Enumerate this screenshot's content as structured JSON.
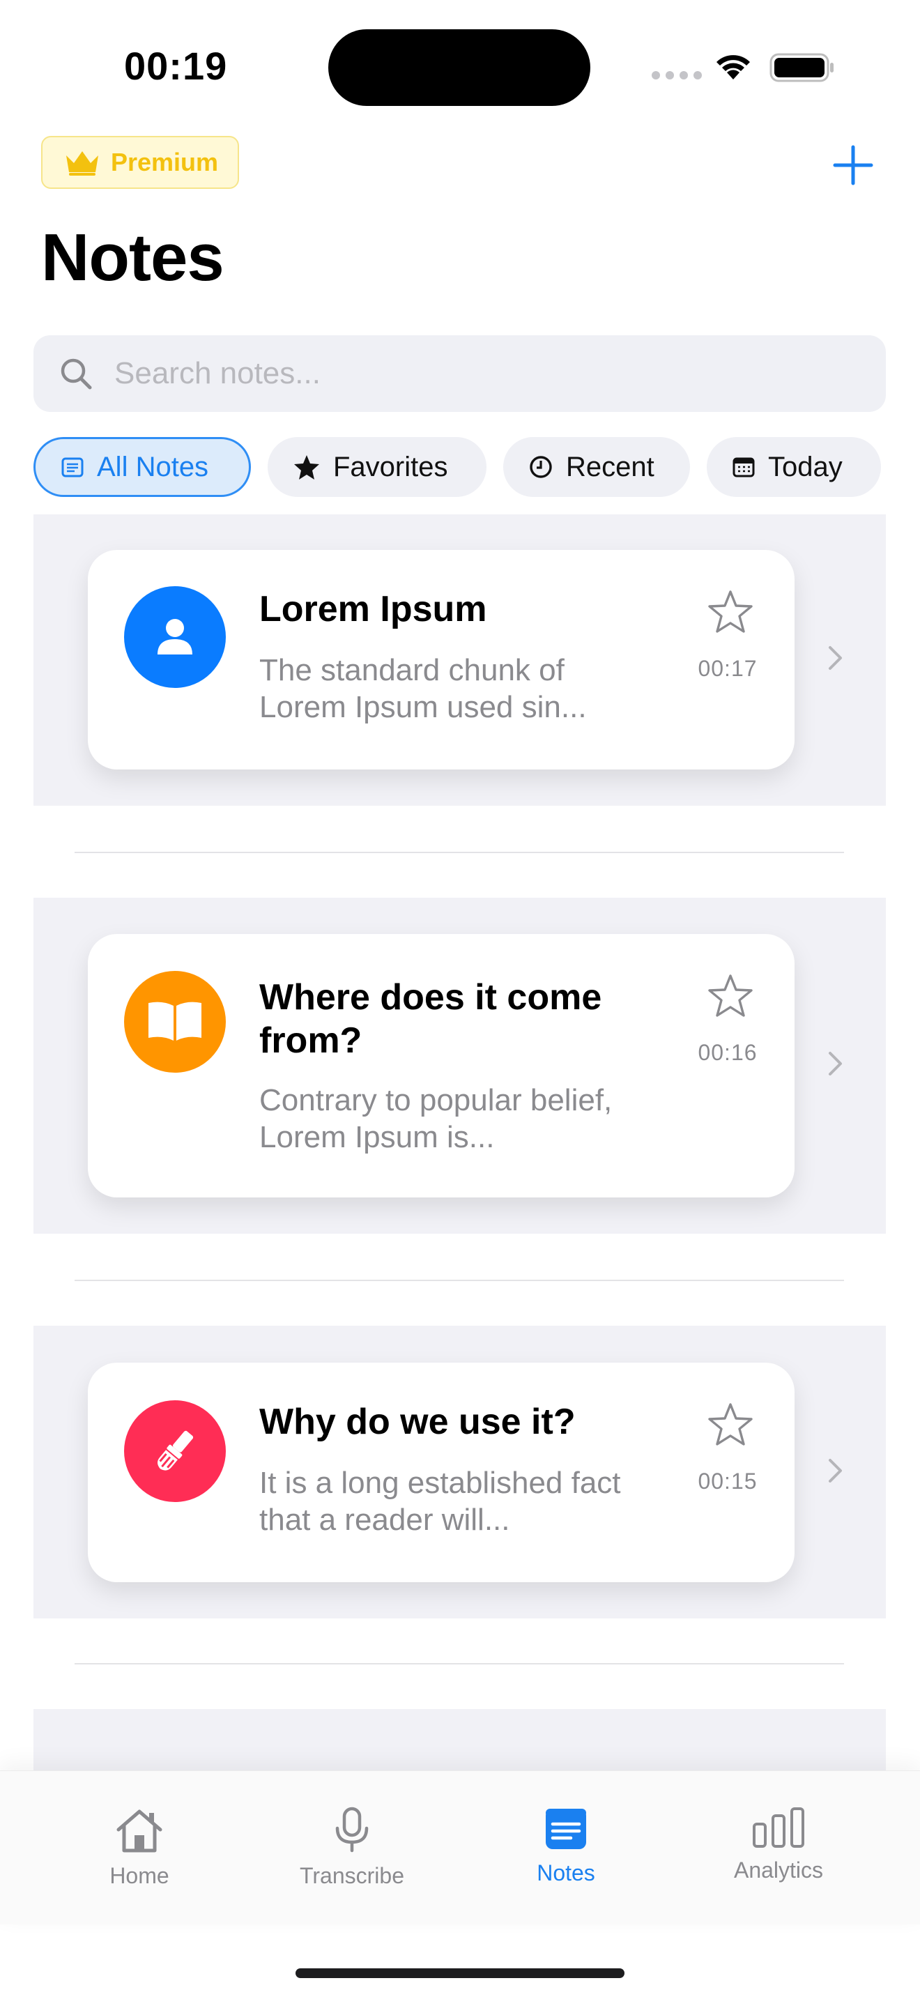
{
  "status": {
    "time": "00:19"
  },
  "header": {
    "premium_label": "Premium",
    "title": "Notes"
  },
  "search": {
    "placeholder": "Search notes..."
  },
  "filters": [
    {
      "label": "All Notes",
      "icon": "list-doc-icon",
      "active": true
    },
    {
      "label": "Favorites",
      "icon": "star-fill-icon",
      "active": false
    },
    {
      "label": "Recent",
      "icon": "clock-icon",
      "active": false
    },
    {
      "label": "Today",
      "icon": "calendar-icon",
      "active": false
    }
  ],
  "notes": [
    {
      "title": "Lorem Ipsum",
      "snippet": "The standard chunk of Lorem Ipsum used sin...",
      "time": "00:17",
      "icon": "person-icon",
      "color": "#0a7cff",
      "favorite": false
    },
    {
      "title": "Where does it come from?",
      "snippet": "Contrary to popular belief, Lorem Ipsum is...",
      "time": "00:16",
      "icon": "book-icon",
      "color": "#ff9500",
      "favorite": false
    },
    {
      "title": "Why do we use it?",
      "snippet": "It is a long established fact that a reader will...",
      "time": "00:15",
      "icon": "paintbrush-icon",
      "color": "#ff2d55",
      "favorite": false
    }
  ],
  "tabs": [
    {
      "label": "Home",
      "icon": "house-icon",
      "active": false
    },
    {
      "label": "Transcribe",
      "icon": "mic-icon",
      "active": false
    },
    {
      "label": "Notes",
      "icon": "notes-icon",
      "active": true
    },
    {
      "label": "Analytics",
      "icon": "chart-bars-icon",
      "active": false
    }
  ],
  "colors": {
    "accent": "#1a80f0",
    "premium": "#f3c10f",
    "secondary_text": "#8a8a8e"
  }
}
